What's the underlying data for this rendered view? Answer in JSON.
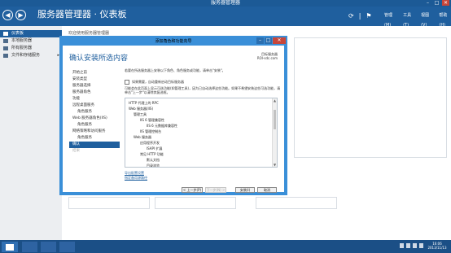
{
  "window": {
    "title": "服务器管理器",
    "min": "–",
    "max": "□",
    "close": "✕"
  },
  "header": {
    "back": "◀",
    "forward": "▶",
    "title": "服务器管理器 · 仪表板",
    "refresh_icon": "refresh-icon",
    "flag_icon": "flag-icon",
    "menu": [
      "管理(M)",
      "工具(T)",
      "视图(V)",
      "帮助(H)"
    ]
  },
  "sidebar": {
    "items": [
      {
        "label": "仪表板",
        "active": true
      },
      {
        "label": "本地服务器",
        "active": false
      },
      {
        "label": "所有服务器",
        "active": false
      },
      {
        "label": "文件和存储服务",
        "active": false,
        "arrow": "▸"
      }
    ]
  },
  "dashboard": {
    "welcome": "欢迎使用服务器管理器",
    "side_label": "隐藏"
  },
  "dialog": {
    "title": "添加角色和功能向导",
    "heading": "确认安装所选内容",
    "target_line1": "目标服务器",
    "target_line2": "ROI-sdc.com",
    "steps": [
      {
        "label": "开始之前",
        "type": "normal"
      },
      {
        "label": "安装类型",
        "type": "normal"
      },
      {
        "label": "服务器选择",
        "type": "normal"
      },
      {
        "label": "服务器角色",
        "type": "normal"
      },
      {
        "label": "功能",
        "type": "normal"
      },
      {
        "label": "远程桌面服务",
        "type": "normal"
      },
      {
        "label": "角色服务",
        "type": "sub"
      },
      {
        "label": "Web 服务器角色(IIS)",
        "type": "normal"
      },
      {
        "label": "角色服务",
        "type": "sub"
      },
      {
        "label": "网络策略和访问服务",
        "type": "normal"
      },
      {
        "label": "角色服务",
        "type": "sub"
      },
      {
        "label": "确认",
        "type": "current"
      },
      {
        "label": "结果",
        "type": "disabled"
      }
    ],
    "description": "若要在所选服务器上安装以下角色、角色服务或功能，请单击\"安装\"。",
    "checkbox_label": "如果需要，自动重新启动目标服务器",
    "description2": "可能会在此页面上显示可选功能(如管理工具)，因为已自动选择这些功能。如果不希望安装这些可选功能，请单击\"上一步\"以清除其复选框。",
    "features": [
      {
        "label": "HTTP 代理上的 RPC",
        "level": 0
      },
      {
        "label": "Web 服务器(IIS)",
        "level": 0
      },
      {
        "label": "管理工具",
        "level": 1
      },
      {
        "label": "IIS 6 管理兼容性",
        "level": 2
      },
      {
        "label": "IIS 6 元数据库兼容性",
        "level": 3
      },
      {
        "label": "IIS 管理控制台",
        "level": 2
      },
      {
        "label": "Web 服务器",
        "level": 1
      },
      {
        "label": "应用程序开发",
        "level": 2
      },
      {
        "label": "ISAPI 扩展",
        "level": 3
      },
      {
        "label": "常见 HTTP 功能",
        "level": 2
      },
      {
        "label": "默认文档",
        "level": 3
      },
      {
        "label": "目录浏览",
        "level": 3
      }
    ],
    "link_export": "导出配置设置",
    "link_source": "指定备用源路径",
    "buttons": {
      "prev": "< 上一步(P)",
      "next": "下一步(N) >",
      "install": "安装(I)",
      "cancel": "取消"
    }
  },
  "taskbar": {
    "time": "16:06",
    "date": "2013/11/13"
  }
}
